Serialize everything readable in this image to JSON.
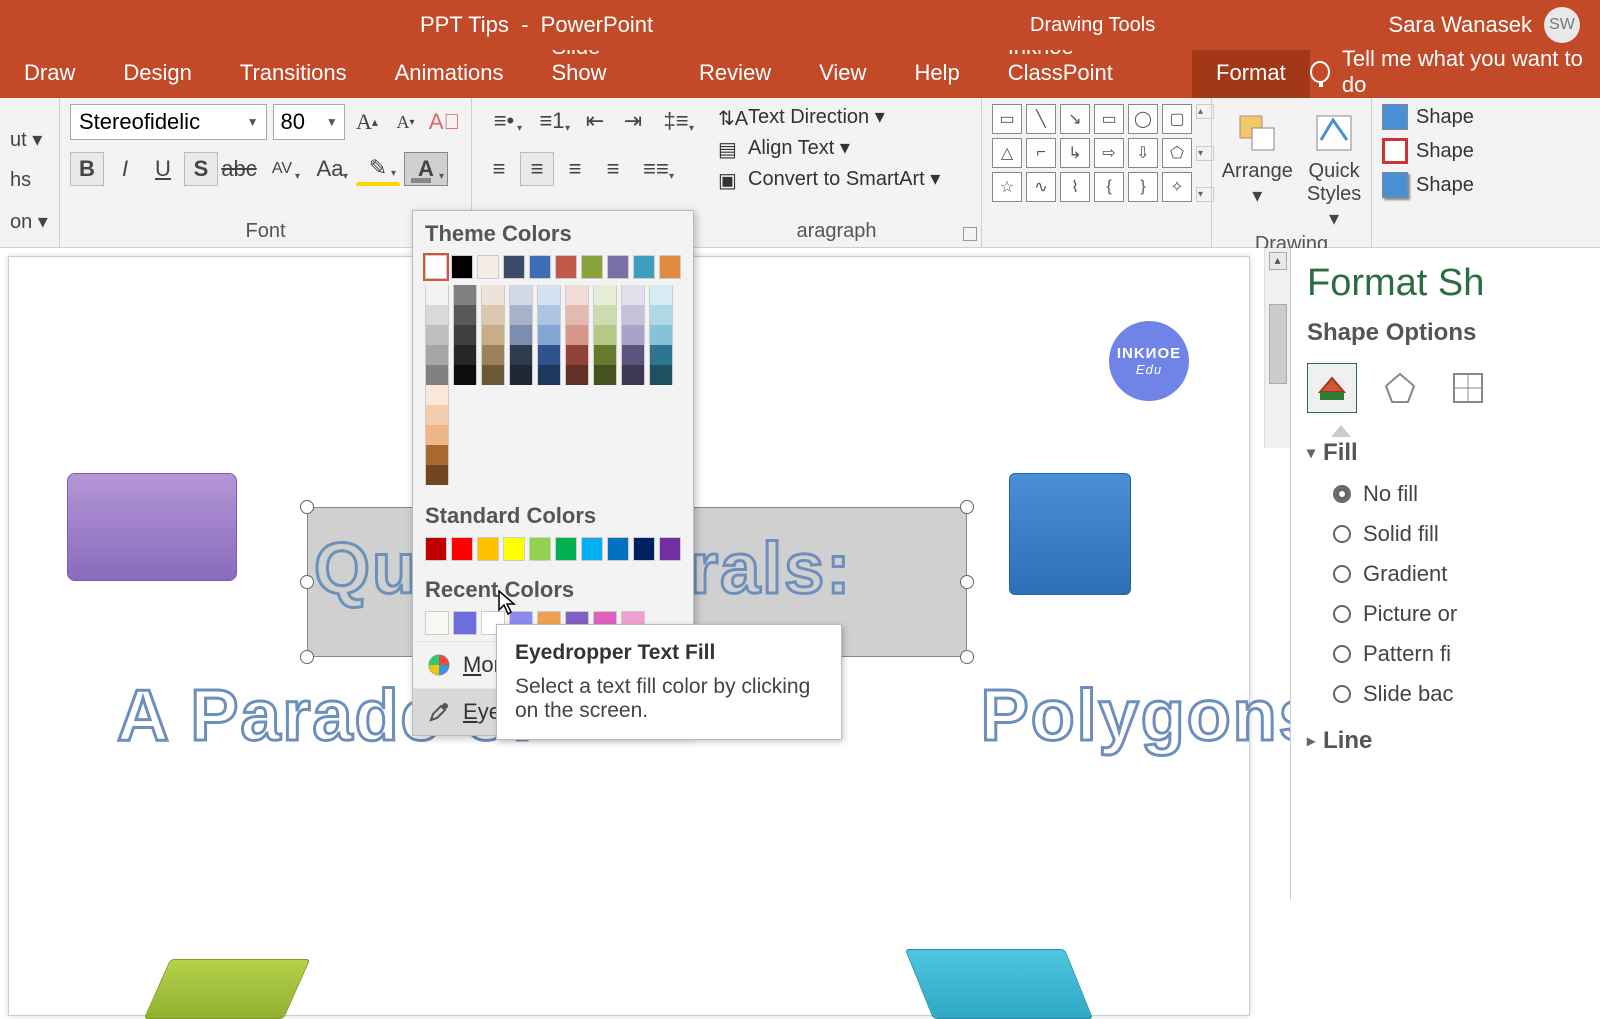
{
  "titlebar": {
    "doc": "PPT Tips",
    "app": "PowerPoint",
    "drawing_tools": "Drawing Tools",
    "user": "Sara Wanasek",
    "initials": "SW"
  },
  "tabs": {
    "draw": "Draw",
    "design": "Design",
    "transitions": "Transitions",
    "animations": "Animations",
    "slideshow": "Slide Show",
    "review": "Review",
    "view": "View",
    "help": "Help",
    "inknoe": "Inknoe ClassPoint",
    "format": "Format",
    "tellme": "Tell me what you want to do"
  },
  "leftfrag": {
    "out": "ut ▾",
    "hs": "hs",
    "on": "on ▾"
  },
  "font": {
    "name": "Stereofidelic",
    "size": "80",
    "group_label": "Font"
  },
  "paragraph": {
    "group_label": "aragraph",
    "text_direction": "Text Direction ▾",
    "align_text": "Align Text ▾",
    "smartart": "Convert to SmartArt ▾"
  },
  "drawing": {
    "arrange": "Arrange",
    "quick_styles": "Quick\nStyles",
    "shape_fill": "Shape",
    "shape_outline": "Shape",
    "shape_effects": "Shape",
    "group_label": "Drawing"
  },
  "color_dd": {
    "theme": "Theme Colors",
    "standard": "Standard Colors",
    "recent": "Recent Colors",
    "more": "More Colors...",
    "eyedropper": "Eyedropper",
    "theme_row": [
      "#ffffff",
      "#000000",
      "#f4ece5",
      "#3d4c66",
      "#3e6db5",
      "#c0594a",
      "#8aa23c",
      "#7b6fa8",
      "#3d9ec0",
      "#e18b3e"
    ],
    "theme_shades": [
      [
        "#f2f2f2",
        "#d9d9d9",
        "#bfbfbf",
        "#a6a6a6",
        "#808080"
      ],
      [
        "#808080",
        "#595959",
        "#404040",
        "#262626",
        "#0d0d0d"
      ],
      [
        "#ece4d8",
        "#dac9b0",
        "#c7ae89",
        "#9d815a",
        "#6d5938"
      ],
      [
        "#d3d9e4",
        "#a8b3c9",
        "#7c8daf",
        "#2e3a4e",
        "#1f2735"
      ],
      [
        "#d6e1f1",
        "#adc4e3",
        "#84a6d5",
        "#2f528c",
        "#1f375d"
      ],
      [
        "#f2dcd8",
        "#e5b9b1",
        "#d8968a",
        "#924338",
        "#613127"
      ],
      [
        "#e6edd6",
        "#cddbae",
        "#b4c986",
        "#67792d",
        "#45511e"
      ],
      [
        "#e3e0ed",
        "#c7c1db",
        "#aba2c9",
        "#5c537e",
        "#3d3754"
      ],
      [
        "#d7ebf2",
        "#afd7e5",
        "#87c3d8",
        "#2e7690",
        "#1f4f60"
      ],
      [
        "#f9e7d7",
        "#f3cfaf",
        "#edb787",
        "#a9682e",
        "#71451f"
      ]
    ],
    "standard_row": [
      "#c00000",
      "#ff0000",
      "#ffc000",
      "#ffff00",
      "#92d050",
      "#00b050",
      "#00b0f0",
      "#0070c0",
      "#002060",
      "#7030a0"
    ],
    "recent_row": [
      "#f8f7f2",
      "#6d6de0",
      "#ffffff",
      "#8a8af0",
      "#f0a050",
      "#8060c0",
      "#e060c0",
      "#f0a0d0"
    ]
  },
  "tooltip": {
    "title": "Eyedropper Text Fill",
    "body": "Select a text fill color by clicking on the screen."
  },
  "slide": {
    "title_text": "Quadrilaterals:",
    "subtitle_a": "A Parade of",
    "subtitle_b": " Polygons",
    "badge": "INKИOE",
    "badge_sub": "Edu"
  },
  "pane": {
    "title": "Format Sh",
    "options": "Shape Options",
    "fill": "Fill",
    "no_fill": "No fill",
    "solid_fill": "Solid fill",
    "gradient": "Gradient",
    "picture": "Picture or",
    "pattern": "Pattern fi",
    "slide_back": "Slide bac",
    "line": "Line"
  }
}
